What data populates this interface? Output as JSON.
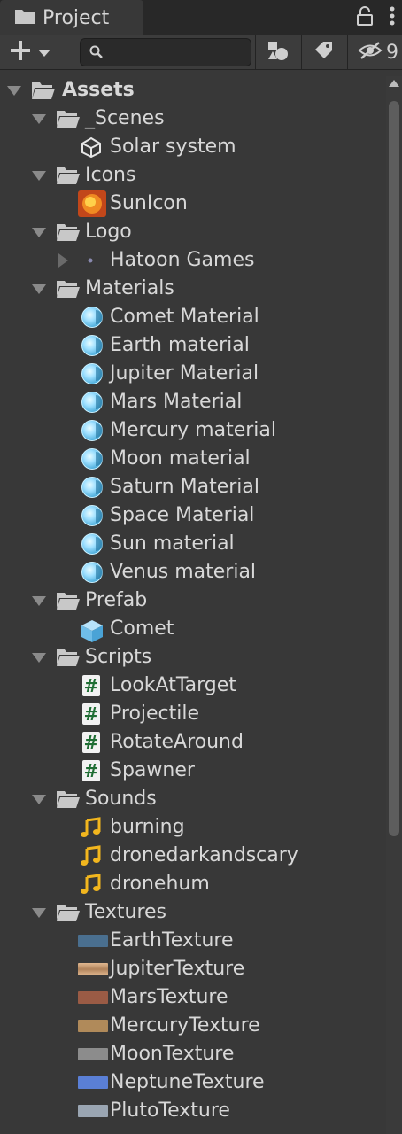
{
  "tab": {
    "label": "Project"
  },
  "toolbar": {
    "hidden_count": "9",
    "search_placeholder": ""
  },
  "tree": {
    "assets": "Assets",
    "scenes": {
      "label": "_Scenes",
      "items": [
        "Solar system"
      ]
    },
    "icons": {
      "label": "Icons",
      "items": [
        "SunIcon"
      ]
    },
    "logo": {
      "label": "Logo",
      "items": [
        "Hatoon Games"
      ]
    },
    "materials": {
      "label": "Materials",
      "items": [
        "Comet Material",
        "Earth material",
        "Jupiter Material",
        "Mars Material",
        "Mercury material",
        "Moon material",
        "Saturn Material",
        "Space Material",
        "Sun material",
        "Venus material"
      ]
    },
    "prefab": {
      "label": "Prefab",
      "items": [
        "Comet"
      ]
    },
    "scripts": {
      "label": "Scripts",
      "items": [
        "LookAtTarget",
        "Projectile",
        "RotateAround",
        "Spawner"
      ]
    },
    "sounds": {
      "label": "Sounds",
      "items": [
        "burning",
        "dronedarkandscary",
        "dronehum"
      ]
    },
    "textures": {
      "label": "Textures",
      "items": [
        "EarthTexture",
        "JupiterTexture",
        "MarsTexture",
        "MercuryTexture",
        "MoonTexture",
        "NeptuneTexture",
        "PlutoTexture"
      ],
      "colors": [
        "#4a6f8f",
        "#c9a27a",
        "#9a5b45",
        "#b08a5a",
        "#8c8c8c",
        "#5a7fd6",
        "#9aa5b2"
      ]
    }
  },
  "colors": {
    "material": "#7fd3ff",
    "sound": "#f2b61e",
    "folder": "#c8c8c8",
    "prefab": "#7fc4ec"
  }
}
